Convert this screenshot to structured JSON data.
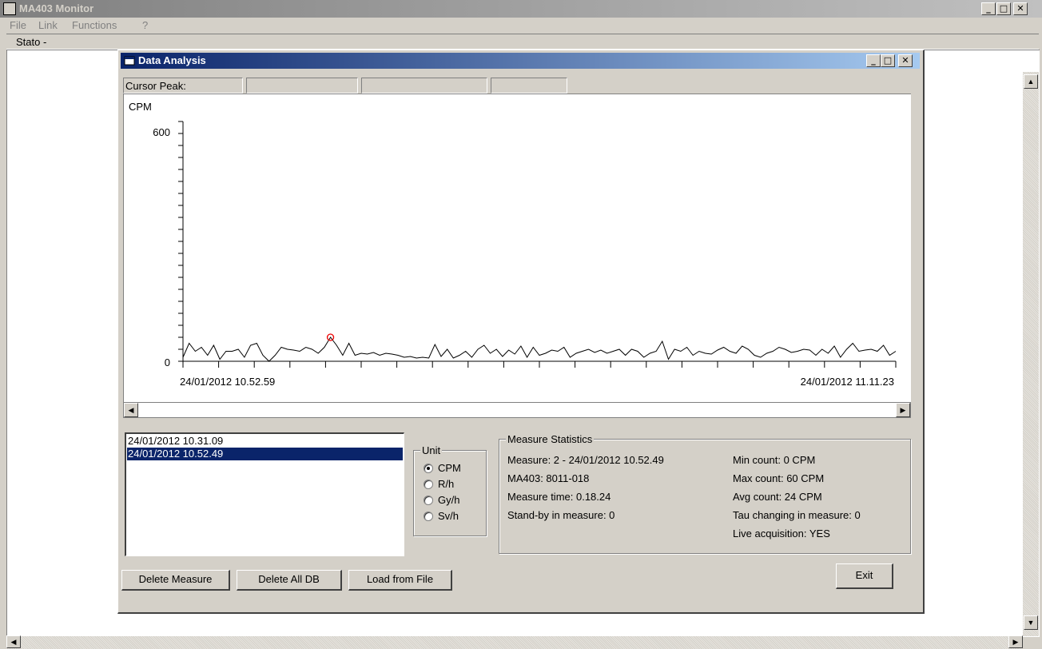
{
  "app": {
    "title": "MA403 Monitor",
    "min": "_",
    "max": "□",
    "close": "✕"
  },
  "menu": [
    "File",
    "Link",
    "Functions",
    "?"
  ],
  "status_label": "Stato -",
  "dialog": {
    "title": "Data Analysis",
    "cursor_peak_label": "Cursor Peak:",
    "cursor_fields": [
      "",
      "",
      ""
    ]
  },
  "chart_data": {
    "type": "line",
    "ylabel": "CPM",
    "ylim": [
      0,
      600
    ],
    "yticks": [
      "600",
      "0"
    ],
    "x_start_label": "24/01/2012 10.52.59",
    "x_end_label": "24/01/2012 11.11.23",
    "values": [
      10,
      45,
      25,
      35,
      15,
      40,
      5,
      25,
      25,
      30,
      10,
      40,
      45,
      15,
      0,
      15,
      35,
      30,
      28,
      25,
      35,
      30,
      20,
      35,
      60,
      40,
      15,
      45,
      15,
      20,
      18,
      22,
      15,
      20,
      18,
      15,
      10,
      12,
      8,
      10,
      8,
      42,
      12,
      30,
      8,
      15,
      25,
      10,
      30,
      40,
      20,
      30,
      12,
      28,
      18,
      38,
      10,
      35,
      15,
      20,
      28,
      25,
      35,
      10,
      20,
      25,
      30,
      22,
      28,
      20,
      25,
      30,
      15,
      30,
      25,
      10,
      20,
      25,
      50,
      5,
      30,
      25,
      35,
      15,
      25,
      20,
      18,
      28,
      35,
      25,
      20,
      38,
      30,
      15,
      10,
      20,
      25,
      35,
      30,
      22,
      25,
      30,
      28,
      15,
      30,
      20,
      38,
      10,
      30,
      45,
      25,
      28,
      30,
      25,
      40,
      15,
      25
    ],
    "peak_index": 24
  },
  "measures_list": [
    {
      "label": "24/01/2012 10.31.09",
      "selected": false
    },
    {
      "label": "24/01/2012 10.52.49",
      "selected": true
    }
  ],
  "unit": {
    "legend": "Unit",
    "options": [
      {
        "label": "CPM",
        "checked": true
      },
      {
        "label": "R/h",
        "checked": false
      },
      {
        "label": "Gy/h",
        "checked": false
      },
      {
        "label": "Sv/h",
        "checked": false
      }
    ]
  },
  "stats": {
    "legend": "Measure Statistics",
    "left": [
      "Measure: 2 - 24/01/2012 10.52.49",
      "MA403: 8011-018",
      "Measure time: 0.18.24",
      "Stand-by in measure: 0"
    ],
    "right": [
      "Min count: 0 CPM",
      "Max count: 60 CPM",
      "Avg count: 24 CPM",
      "Tau changing in measure: 0",
      "Live acquisition: YES"
    ]
  },
  "buttons": {
    "delete_measure": "Delete Measure",
    "delete_all": "Delete All DB",
    "load_file": "Load from File",
    "exit": "Exit"
  }
}
